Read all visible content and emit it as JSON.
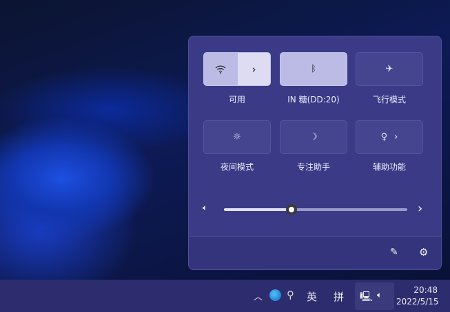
{
  "quick_settings": {
    "tiles": [
      {
        "label": "可用",
        "icon": "wifi-icon",
        "active": true
      },
      {
        "label": "IN 糖(DD:20)",
        "icon": "bluetooth-icon",
        "active": true
      },
      {
        "label": "飞行模式",
        "icon": "airplane-icon",
        "active": false
      },
      {
        "label": "夜间模式",
        "icon": "night-light-icon",
        "active": false
      },
      {
        "label": "专注助手",
        "icon": "moon-icon",
        "active": false
      },
      {
        "label": "辅助功能",
        "icon": "accessibility-icon",
        "active": false
      }
    ],
    "volume_percent": 37
  },
  "taskbar": {
    "ime_lang": "英",
    "ime_mode": "拼",
    "time": "20:48",
    "date": "2022/5/15"
  }
}
